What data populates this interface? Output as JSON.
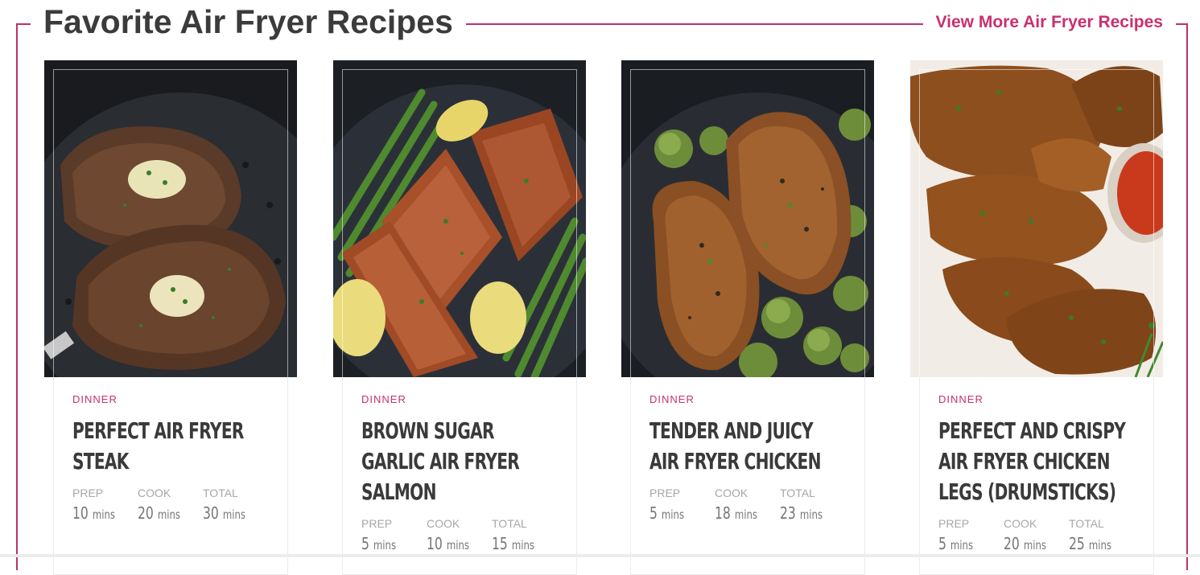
{
  "section": {
    "title": "Favorite Air Fryer Recipes",
    "view_more": "View More Air Fryer Recipes",
    "accent_color": "#c9306f",
    "border_color": "#b8336a"
  },
  "recipes": [
    {
      "category": "DINNER",
      "title": "Perfect Air Fryer Steak",
      "image": "air-fryer-steak-photo",
      "prep_label": "PREP",
      "prep": "10",
      "cook_label": "COOK",
      "cook": "20",
      "total_label": "TOTAL",
      "total": "30",
      "unit": "mins"
    },
    {
      "category": "DINNER",
      "title": "Brown Sugar Garlic Air Fryer Salmon",
      "image": "air-fryer-salmon-photo",
      "prep_label": "PREP",
      "prep": "5",
      "cook_label": "COOK",
      "cook": "10",
      "total_label": "TOTAL",
      "total": "15",
      "unit": "mins"
    },
    {
      "category": "DINNER",
      "title": "Tender and Juicy Air Fryer Chicken",
      "image": "air-fryer-chicken-photo",
      "prep_label": "PREP",
      "prep": "5",
      "cook_label": "COOK",
      "cook": "18",
      "total_label": "TOTAL",
      "total": "23",
      "unit": "mins"
    },
    {
      "category": "DINNER",
      "title": "Perfect and Crispy Air Fryer Chicken Legs (Drumsticks)",
      "image": "air-fryer-drumsticks-photo",
      "prep_label": "PREP",
      "prep": "5",
      "cook_label": "COOK",
      "cook": "20",
      "total_label": "TOTAL",
      "total": "25",
      "unit": "mins"
    }
  ]
}
